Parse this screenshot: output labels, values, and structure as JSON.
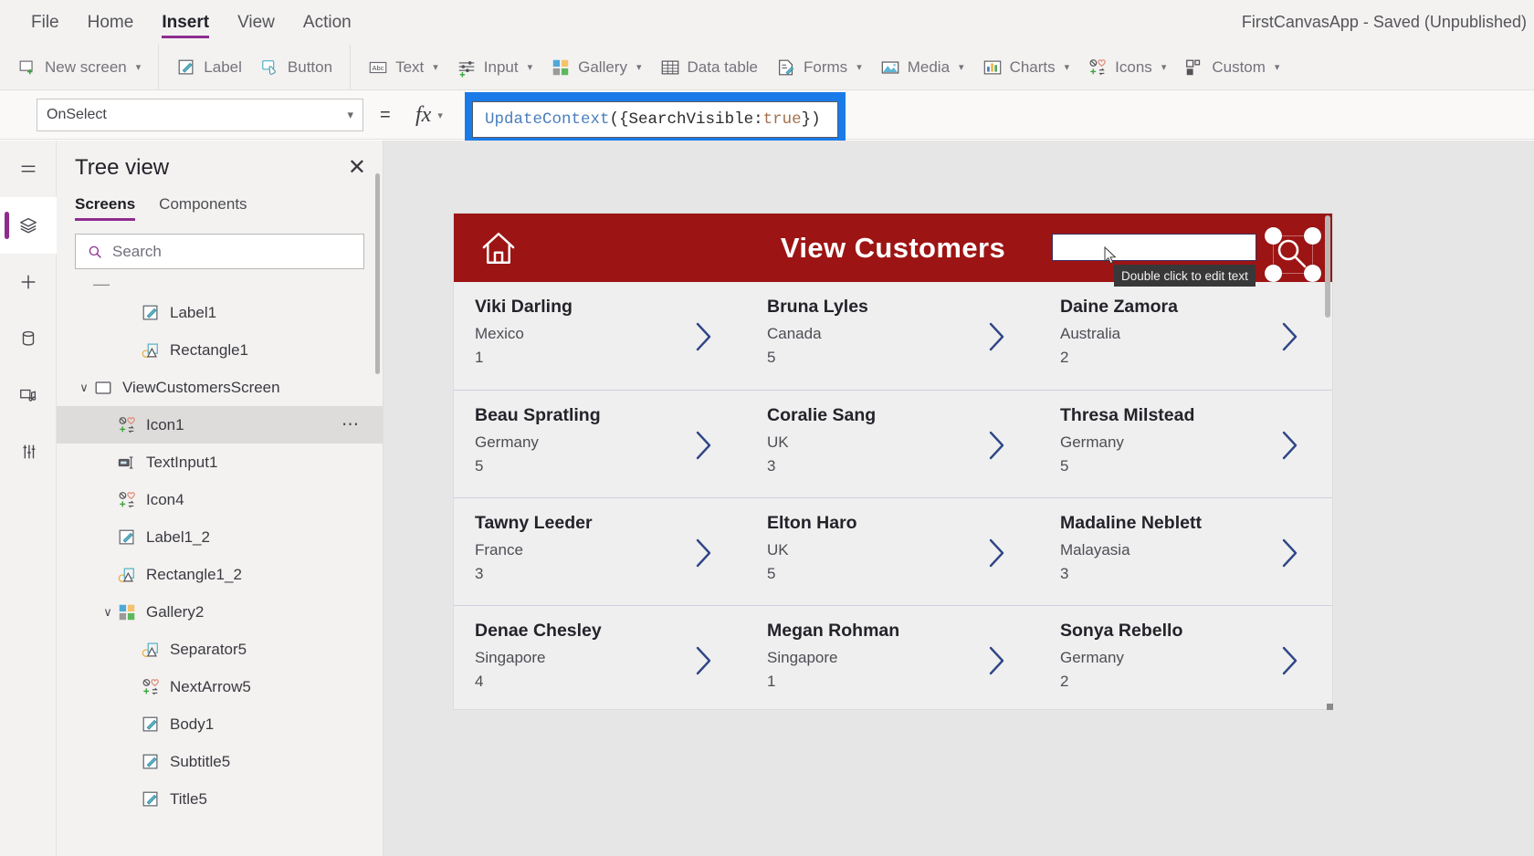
{
  "menubar": {
    "items": [
      {
        "label": "File",
        "active": false
      },
      {
        "label": "Home",
        "active": false
      },
      {
        "label": "Insert",
        "active": true
      },
      {
        "label": "View",
        "active": false
      },
      {
        "label": "Action",
        "active": false
      }
    ],
    "app_title": "FirstCanvasApp - Saved (Unpublished)"
  },
  "ribbon": {
    "groups": [
      [
        {
          "label": "New screen",
          "icon": "new-screen-icon",
          "chevron": true
        }
      ],
      [
        {
          "label": "Label",
          "icon": "label-icon",
          "chevron": false
        },
        {
          "label": "Button",
          "icon": "button-icon",
          "chevron": false
        }
      ],
      [
        {
          "label": "Text",
          "icon": "text-icon",
          "chevron": true
        },
        {
          "label": "Input",
          "icon": "input-icon",
          "chevron": true
        },
        {
          "label": "Gallery",
          "icon": "gallery-icon",
          "chevron": true
        },
        {
          "label": "Data table",
          "icon": "data-table-icon",
          "chevron": false
        },
        {
          "label": "Forms",
          "icon": "forms-icon",
          "chevron": true
        },
        {
          "label": "Media",
          "icon": "media-icon",
          "chevron": true
        },
        {
          "label": "Charts",
          "icon": "charts-icon",
          "chevron": true
        },
        {
          "label": "Icons",
          "icon": "icons-icon",
          "chevron": true
        },
        {
          "label": "Custom",
          "icon": "custom-icon",
          "chevron": true
        }
      ]
    ]
  },
  "formula_bar": {
    "property": "OnSelect",
    "equals": "=",
    "fx": "fx",
    "formula_tokens": [
      {
        "text": "UpdateContext",
        "type": "fn"
      },
      {
        "text": "({",
        "type": "punct"
      },
      {
        "text": "SearchVisible",
        "type": "id"
      },
      {
        "text": ": ",
        "type": "punct"
      },
      {
        "text": "true",
        "type": "bool"
      },
      {
        "text": "})",
        "type": "punct"
      }
    ]
  },
  "rail": {
    "items": [
      {
        "name": "hamburger-menu-icon",
        "active": false
      },
      {
        "name": "tree-view-icon",
        "active": true
      },
      {
        "name": "insert-plus-icon",
        "active": false
      },
      {
        "name": "data-source-icon",
        "active": false
      },
      {
        "name": "media-library-icon",
        "active": false
      },
      {
        "name": "advanced-tools-icon",
        "active": false
      }
    ]
  },
  "tree_panel": {
    "title": "Tree view",
    "close_label": "✕",
    "tabs": [
      {
        "label": "Screens",
        "active": true
      },
      {
        "label": "Components",
        "active": false
      }
    ],
    "search_placeholder": "Search",
    "nodes": [
      {
        "label": "Label1",
        "icon": "label-icon",
        "indent": 2,
        "twist": "",
        "selected": false,
        "dots": false
      },
      {
        "label": "Rectangle1",
        "icon": "shape-icon",
        "indent": 2,
        "twist": "",
        "selected": false,
        "dots": false
      },
      {
        "label": "ViewCustomersScreen",
        "icon": "screen-icon",
        "indent": 0,
        "twist": "∨",
        "selected": false,
        "dots": false
      },
      {
        "label": "Icon1",
        "icon": "icons-icon",
        "indent": 1,
        "twist": "",
        "selected": true,
        "dots": true
      },
      {
        "label": "TextInput1",
        "icon": "text-input-icon",
        "indent": 1,
        "twist": "",
        "selected": false,
        "dots": false
      },
      {
        "label": "Icon4",
        "icon": "icons-icon",
        "indent": 1,
        "twist": "",
        "selected": false,
        "dots": false
      },
      {
        "label": "Label1_2",
        "icon": "label-icon",
        "indent": 1,
        "twist": "",
        "selected": false,
        "dots": false
      },
      {
        "label": "Rectangle1_2",
        "icon": "shape-icon",
        "indent": 1,
        "twist": "",
        "selected": false,
        "dots": false
      },
      {
        "label": "Gallery2",
        "icon": "gallery-icon",
        "indent": 1,
        "twist": "∨",
        "selected": false,
        "dots": false
      },
      {
        "label": "Separator5",
        "icon": "shape-icon",
        "indent": 2,
        "twist": "",
        "selected": false,
        "dots": false
      },
      {
        "label": "NextArrow5",
        "icon": "icons-icon",
        "indent": 2,
        "twist": "",
        "selected": false,
        "dots": false
      },
      {
        "label": "Body1",
        "icon": "label-icon",
        "indent": 2,
        "twist": "",
        "selected": false,
        "dots": false
      },
      {
        "label": "Subtitle5",
        "icon": "label-icon",
        "indent": 2,
        "twist": "",
        "selected": false,
        "dots": false
      },
      {
        "label": "Title5",
        "icon": "label-icon",
        "indent": 2,
        "twist": "",
        "selected": false,
        "dots": false
      }
    ]
  },
  "canvas": {
    "header": {
      "title": "View Customers",
      "home_icon": "home-icon",
      "search_input_value": "",
      "search_icon": "magnifier-icon"
    },
    "tooltip": "Double click to edit text",
    "gallery": [
      [
        {
          "title": "Viki  Darling",
          "subtitle": "Mexico",
          "body": "1"
        },
        {
          "title": "Bruna  Lyles",
          "subtitle": "Canada",
          "body": "5"
        },
        {
          "title": "Daine  Zamora",
          "subtitle": "Australia",
          "body": "2"
        }
      ],
      [
        {
          "title": "Beau  Spratling",
          "subtitle": "Germany",
          "body": "5"
        },
        {
          "title": "Coralie  Sang",
          "subtitle": "UK",
          "body": "3"
        },
        {
          "title": "Thresa  Milstead",
          "subtitle": "Germany",
          "body": "5"
        }
      ],
      [
        {
          "title": "Tawny  Leeder",
          "subtitle": "France",
          "body": "3"
        },
        {
          "title": "Elton  Haro",
          "subtitle": "UK",
          "body": "5"
        },
        {
          "title": "Madaline  Neblett",
          "subtitle": "Malayasia",
          "body": "3"
        }
      ],
      [
        {
          "title": "Denae Chesley",
          "subtitle": "Singapore",
          "body": "4"
        },
        {
          "title": "Megan Rohman",
          "subtitle": "Singapore",
          "body": "1"
        },
        {
          "title": "Sonya Rebello",
          "subtitle": "Germany",
          "body": "2"
        }
      ]
    ]
  },
  "colors": {
    "brand_purple": "#8e2d8e",
    "app_header_red": "#9d1414",
    "selection_blue": "#1a7ae8",
    "arrow_navy": "#2f4686"
  }
}
